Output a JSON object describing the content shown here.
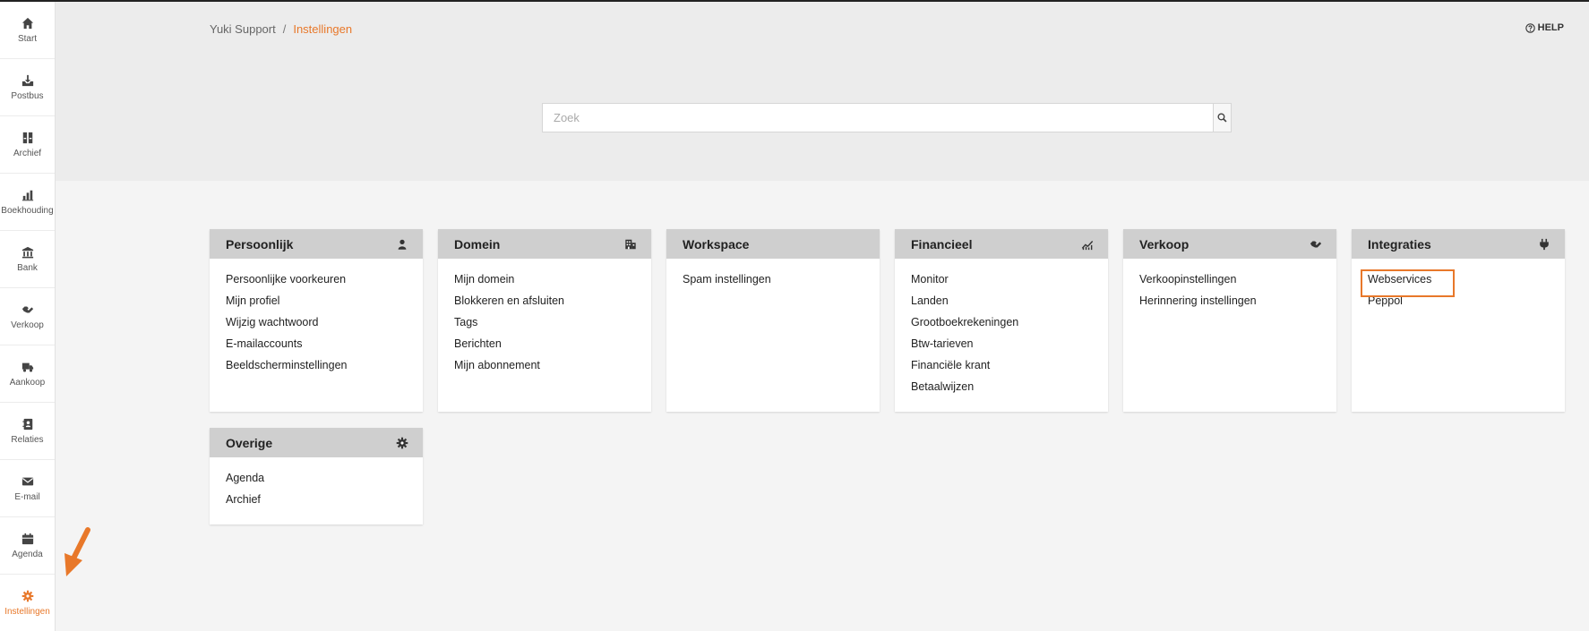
{
  "breadcrumb": {
    "root": "Yuki Support",
    "separator": "/",
    "current": "Instellingen"
  },
  "help_label": "HELP",
  "search": {
    "placeholder": "Zoek",
    "value": ""
  },
  "sidebar": {
    "items": [
      {
        "label": "Start",
        "icon": "home-icon"
      },
      {
        "label": "Postbus",
        "icon": "inbox-icon"
      },
      {
        "label": "Archief",
        "icon": "archive-icon"
      },
      {
        "label": "Boekhouding",
        "icon": "bar-chart-icon"
      },
      {
        "label": "Bank",
        "icon": "bank-icon"
      },
      {
        "label": "Verkoop",
        "icon": "handshake-icon"
      },
      {
        "label": "Aankoop",
        "icon": "truck-icon"
      },
      {
        "label": "Relaties",
        "icon": "address-book-icon"
      },
      {
        "label": "E-mail",
        "icon": "envelope-icon"
      },
      {
        "label": "Agenda",
        "icon": "calendar-icon"
      },
      {
        "label": "Instellingen",
        "icon": "gear-icon",
        "active": true
      }
    ]
  },
  "cards": {
    "persoonlijk": {
      "title": "Persoonlijk",
      "icon": "user-icon",
      "links": [
        "Persoonlijke voorkeuren",
        "Mijn profiel",
        "Wijzig wachtwoord",
        "E-mailaccounts",
        "Beeldscherminstellingen"
      ]
    },
    "domein": {
      "title": "Domein",
      "icon": "building-icon",
      "links": [
        "Mijn domein",
        "Blokkeren en afsluiten",
        "Tags",
        "Berichten",
        "Mijn abonnement"
      ]
    },
    "workspace": {
      "title": "Workspace",
      "links": [
        "Spam instellingen"
      ]
    },
    "financieel": {
      "title": "Financieel",
      "icon": "chart-line-icon",
      "links": [
        "Monitor",
        "Landen",
        "Grootboekrekeningen",
        "Btw-tarieven",
        "Financiële krant",
        "Betaalwijzen"
      ]
    },
    "verkoop": {
      "title": "Verkoop",
      "icon": "handshake-icon",
      "links": [
        "Verkoopinstellingen",
        "Herinnering instellingen"
      ]
    },
    "integraties": {
      "title": "Integraties",
      "icon": "plug-icon",
      "links": [
        "Webservices",
        "Peppol"
      ]
    },
    "overige": {
      "title": "Overige",
      "icon": "gear-icon",
      "links": [
        "Agenda",
        "Archief"
      ]
    }
  },
  "colors": {
    "accent": "#e8782a",
    "header_bg": "#ececec",
    "card_head": "#cfcfcf",
    "page_bg": "#f4f4f4"
  }
}
